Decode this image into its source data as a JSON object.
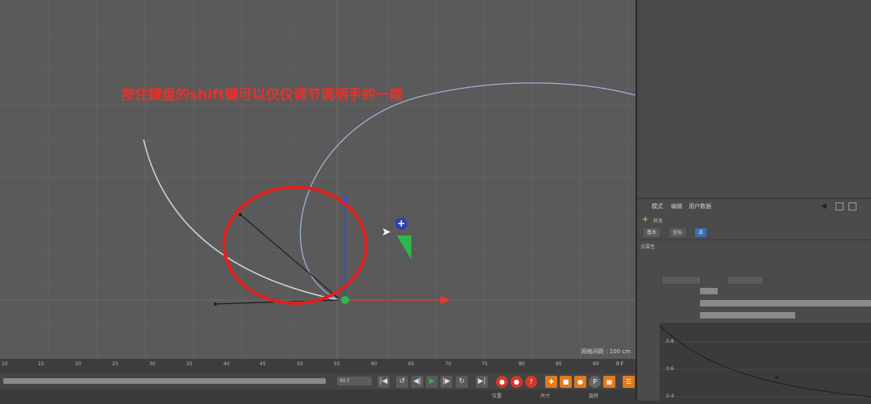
{
  "viewport": {
    "annotation": "按住键盘的shift键可以仅仅调节调柄手的一端",
    "grid_size_label": "网格间距 : 100 cm"
  },
  "attributes": {
    "menu": [
      "模式",
      "编辑",
      "用户数据"
    ],
    "object_label": "样条",
    "tabs": [
      "基本",
      "坐标",
      "点"
    ],
    "section_title": "点属性"
  },
  "timeline": {
    "ruler_ticks": [
      "10",
      "15",
      "20",
      "25",
      "30",
      "35",
      "40",
      "45",
      "50",
      "55",
      "60",
      "65",
      "70",
      "75",
      "80",
      "85",
      "90"
    ],
    "ruler_end": "0 F",
    "current_frame": "90 F"
  },
  "bottom_labels": [
    "位置",
    "尺寸",
    "旋转"
  ],
  "curve_axis_labels": [
    "0.8",
    "0.6",
    "0.4"
  ],
  "colors": {
    "annotation": "#e8312a",
    "circle": "#e02020",
    "x_axis": "#e03a2a",
    "y_axis": "#3050d0",
    "handle_green": "#2fb84a",
    "tab_active": "#3b6fb3"
  },
  "icons": [
    "plus-icon",
    "arrow-cursor-icon",
    "record-icon",
    "play-icon"
  ]
}
